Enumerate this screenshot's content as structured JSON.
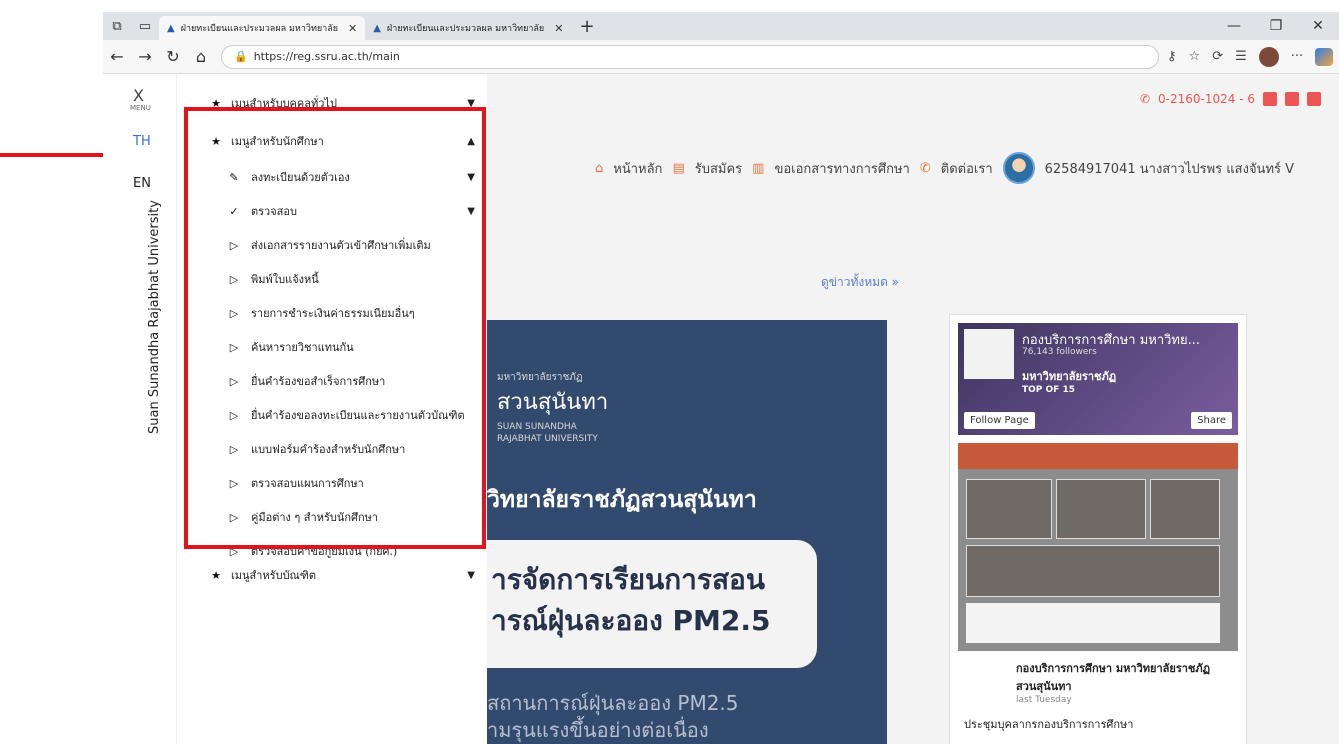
{
  "browser": {
    "tabs": [
      {
        "title": "ฝ่ายทะเบียนและประมวลผล มหาวิทยาลัย",
        "active": true
      },
      {
        "title": "ฝ่ายทะเบียนและประมวลผล มหาวิทยาลัย",
        "active": false
      }
    ],
    "url": "https://reg.ssru.ac.th/main"
  },
  "sidebar": {
    "close": "X",
    "menu_label": "MENU",
    "lang_th": "TH",
    "lang_en": "EN",
    "vertical_title": "Suan Sunandha Rajabhat University"
  },
  "menu": {
    "general": "เมนูสำหรับบุคคลทั่วไป",
    "student": "เมนูสำหรับนักศึกษา",
    "self_register": "ลงทะเบียนด้วยตัวเอง",
    "check": "ตรวจสอบ",
    "items": [
      "ส่งเอกสารรายงานตัวเข้าศึกษาเพิ่มเติม",
      "พิมพ์ใบแจ้งหนี้",
      "รายการชำระเงินค่าธรรมเนียมอื่นๆ",
      "ค้นหารายวิชาแทนกัน",
      "ยื่นคำร้องขอสำเร็จการศึกษา",
      "ยื่นคำร้องขอลงทะเบียนและรายงานตัวบัณฑิต",
      "แบบฟอร์มคำร้องสำหรับนักศึกษา",
      "ตรวจสอบแผนการศึกษา",
      "คู่มือต่าง ๆ สำหรับนักศึกษา",
      "ตรวจสอบคำขอกู้ยืมเงิน (กยศ.)"
    ],
    "graduate": "เมนูสำหรับบัณฑิต"
  },
  "page": {
    "phone": "0-2160-1024 - 6",
    "nav": {
      "home": "หน้าหลัก",
      "apply": "รับสมัคร",
      "docs": "ขอเอกสารทางการศึกษา",
      "contact": "ติดต่อเรา",
      "user": "62584917041 นางสาวไปรพร แสงจันทร์ V"
    },
    "news_all": "ดูข่าวทั้งหมด »",
    "banner": {
      "logo_th": "มหาวิทยาลัยราชภัฏ",
      "logo_name": "สวนสุนันทา",
      "logo_en": "SUAN SUNANDHA\nRAJABHAT UNIVERSITY",
      "uni": "วิทยาลัยราชภัฏสวนสุนันทา",
      "pill_line1": "ารจัดการเรียนการสอน",
      "pill_line2": "ารณ์ฝุ่นละออง PM2.5",
      "foot_line1": "สถานการณ์ฝุ่นละออง PM2.5",
      "foot_line2": "ามรุนแรงขึ้นอย่างต่อเนื่อง"
    },
    "facebook": {
      "title": "กองบริการการศึกษา มหาวิทย...",
      "followers": "76,143 followers",
      "banner_text": "มหาวิทยาลัยราชภัฏ",
      "top": "TOP OF 15",
      "follow": "Follow Page",
      "share": "Share",
      "post_name": "กองบริการการศึกษา มหาวิทยาลัยราชภัฏสวนสุนันทา",
      "post_date": "last Tuesday",
      "post_text": "ประชุมบุคลากรกองบริการการศึกษา"
    }
  }
}
